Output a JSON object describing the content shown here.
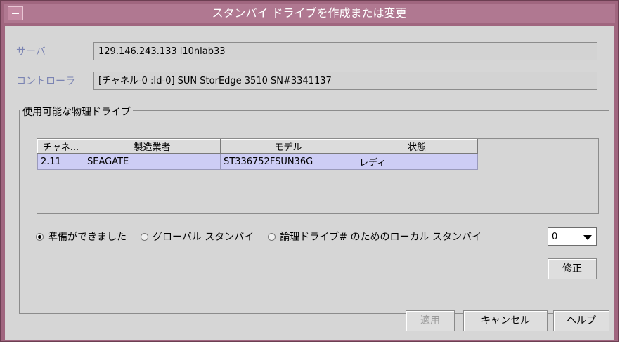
{
  "window": {
    "title": "スタンバイ ドライブを作成または変更"
  },
  "server": {
    "label": "サーバ",
    "value": "129.146.243.133 l10nlab33"
  },
  "controller": {
    "label": "コントローラ",
    "value": "[チャネル-0 :Id-0] SUN StorEdge 3510 SN#3341137"
  },
  "drives": {
    "group_title": "使用可能な物理ドライブ",
    "columns": [
      "チャネ...",
      "製造業者",
      "モデル",
      "状態"
    ],
    "rows": [
      [
        "2.11",
        "SEAGATE",
        "ST336752FSUN36G",
        "レディ"
      ]
    ]
  },
  "options": {
    "ready": "準備ができました",
    "global": "グローバル スタンバイ",
    "local": "論理ドライブ# のためのローカル スタンバイ",
    "selected": "ready",
    "logical_drive_value": "0"
  },
  "buttons": {
    "modify": "修正",
    "apply": "適用",
    "cancel": "キャンセル",
    "help": "ヘルプ"
  }
}
